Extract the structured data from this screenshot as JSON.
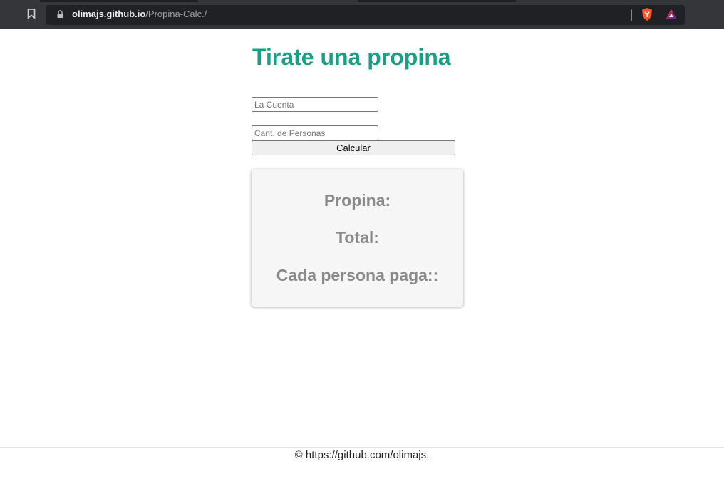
{
  "browser": {
    "url_host": "olimajs.github.io",
    "url_path": "/Propina-Calc./",
    "icons": [
      "bookmark-icon",
      "lock-icon",
      "brave-shields-icon",
      "brave-rewards-icon"
    ]
  },
  "app": {
    "title": "Tirate una propina",
    "bill_input": {
      "placeholder": "La Cuenta",
      "value": ""
    },
    "people_input": {
      "placeholder": "Cant. de Personas",
      "value": ""
    },
    "calculate_label": "Calcular"
  },
  "results": {
    "tip_label": "Propina:",
    "total_label": "Total:",
    "per_person_label": "Cada persona paga::"
  },
  "footer": {
    "text": "© https://github.com/olimajs."
  },
  "colors": {
    "accent": "#16a085",
    "result_text": "#8a8a8a",
    "chrome": "#35363a"
  }
}
